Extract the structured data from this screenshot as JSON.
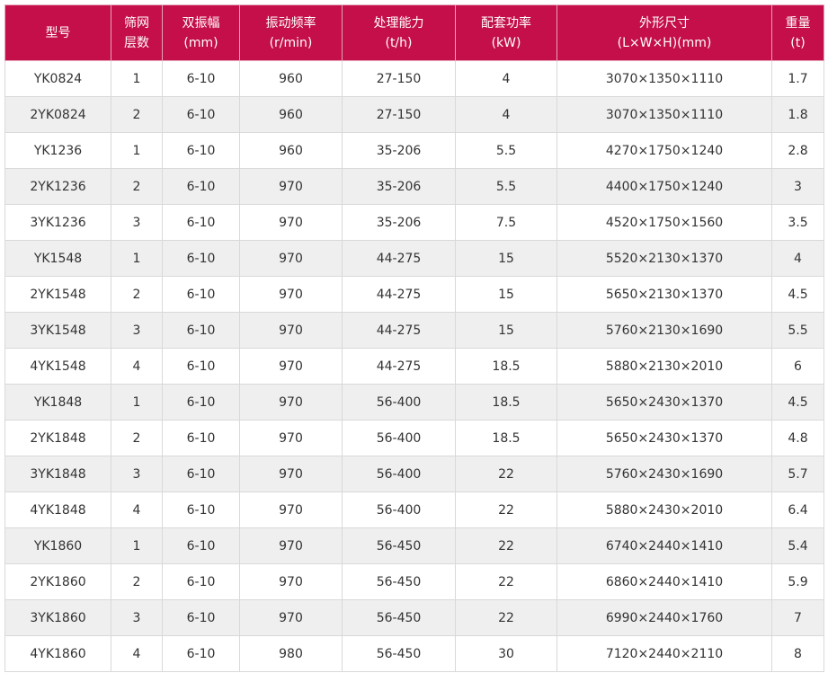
{
  "colors": {
    "header_bg": "#c40f4a",
    "header_text": "#ffffff",
    "row_alt": "#efefef"
  },
  "headers": [
    [
      "型号"
    ],
    [
      "筛网",
      "层数"
    ],
    [
      "双振幅",
      "(mm)"
    ],
    [
      "振动频率",
      "(r/min)"
    ],
    [
      "处理能力",
      "(t/h)"
    ],
    [
      "配套功率",
      "(kW)"
    ],
    [
      "外形尺寸",
      "(L×W×H)(mm)"
    ],
    [
      "重量",
      "(t)"
    ]
  ],
  "rows": [
    [
      "YK0824",
      "1",
      "6-10",
      "960",
      "27-150",
      "4",
      "3070×1350×1110",
      "1.7"
    ],
    [
      "2YK0824",
      "2",
      "6-10",
      "960",
      "27-150",
      "4",
      "3070×1350×1110",
      "1.8"
    ],
    [
      "YK1236",
      "1",
      "6-10",
      "960",
      "35-206",
      "5.5",
      "4270×1750×1240",
      "2.8"
    ],
    [
      "2YK1236",
      "2",
      "6-10",
      "970",
      "35-206",
      "5.5",
      "4400×1750×1240",
      "3"
    ],
    [
      "3YK1236",
      "3",
      "6-10",
      "970",
      "35-206",
      "7.5",
      "4520×1750×1560",
      "3.5"
    ],
    [
      "YK1548",
      "1",
      "6-10",
      "970",
      "44-275",
      "15",
      "5520×2130×1370",
      "4"
    ],
    [
      "2YK1548",
      "2",
      "6-10",
      "970",
      "44-275",
      "15",
      "5650×2130×1370",
      "4.5"
    ],
    [
      "3YK1548",
      "3",
      "6-10",
      "970",
      "44-275",
      "15",
      "5760×2130×1690",
      "5.5"
    ],
    [
      "4YK1548",
      "4",
      "6-10",
      "970",
      "44-275",
      "18.5",
      "5880×2130×2010",
      "6"
    ],
    [
      "YK1848",
      "1",
      "6-10",
      "970",
      "56-400",
      "18.5",
      "5650×2430×1370",
      "4.5"
    ],
    [
      "2YK1848",
      "2",
      "6-10",
      "970",
      "56-400",
      "18.5",
      "5650×2430×1370",
      "4.8"
    ],
    [
      "3YK1848",
      "3",
      "6-10",
      "970",
      "56-400",
      "22",
      "5760×2430×1690",
      "5.7"
    ],
    [
      "4YK1848",
      "4",
      "6-10",
      "970",
      "56-400",
      "22",
      "5880×2430×2010",
      "6.4"
    ],
    [
      "YK1860",
      "1",
      "6-10",
      "970",
      "56-450",
      "22",
      "6740×2440×1410",
      "5.4"
    ],
    [
      "2YK1860",
      "2",
      "6-10",
      "970",
      "56-450",
      "22",
      "6860×2440×1410",
      "5.9"
    ],
    [
      "3YK1860",
      "3",
      "6-10",
      "970",
      "56-450",
      "22",
      "6990×2440×1760",
      "7"
    ],
    [
      "4YK1860",
      "4",
      "6-10",
      "980",
      "56-450",
      "30",
      "7120×2440×2110",
      "8"
    ]
  ]
}
